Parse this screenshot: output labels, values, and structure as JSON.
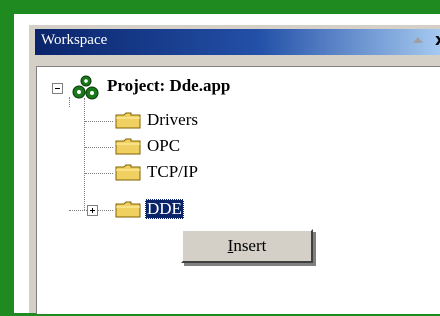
{
  "window": {
    "title": "Workspace",
    "close_glyph": "x"
  },
  "tree": {
    "root_label": "Project: Dde.app",
    "root_icon": "project-gears-icon",
    "children": [
      {
        "label": "Drivers",
        "icon": "folder-icon"
      },
      {
        "label": "OPC",
        "icon": "folder-icon"
      },
      {
        "label": "TCP/IP",
        "icon": "folder-icon"
      },
      {
        "label": "DDE",
        "icon": "folder-icon",
        "selected": true,
        "expandable": true
      }
    ]
  },
  "context_menu": {
    "items": [
      {
        "label": "Insert"
      }
    ]
  },
  "colors": {
    "frame_border": "#1f8a1f",
    "titlebar_start": "#0a246a",
    "titlebar_end": "#a6caf0",
    "selection": "#0a246a",
    "panel_bg": "#d4d0c8",
    "folder_fill": "#f0d060"
  }
}
